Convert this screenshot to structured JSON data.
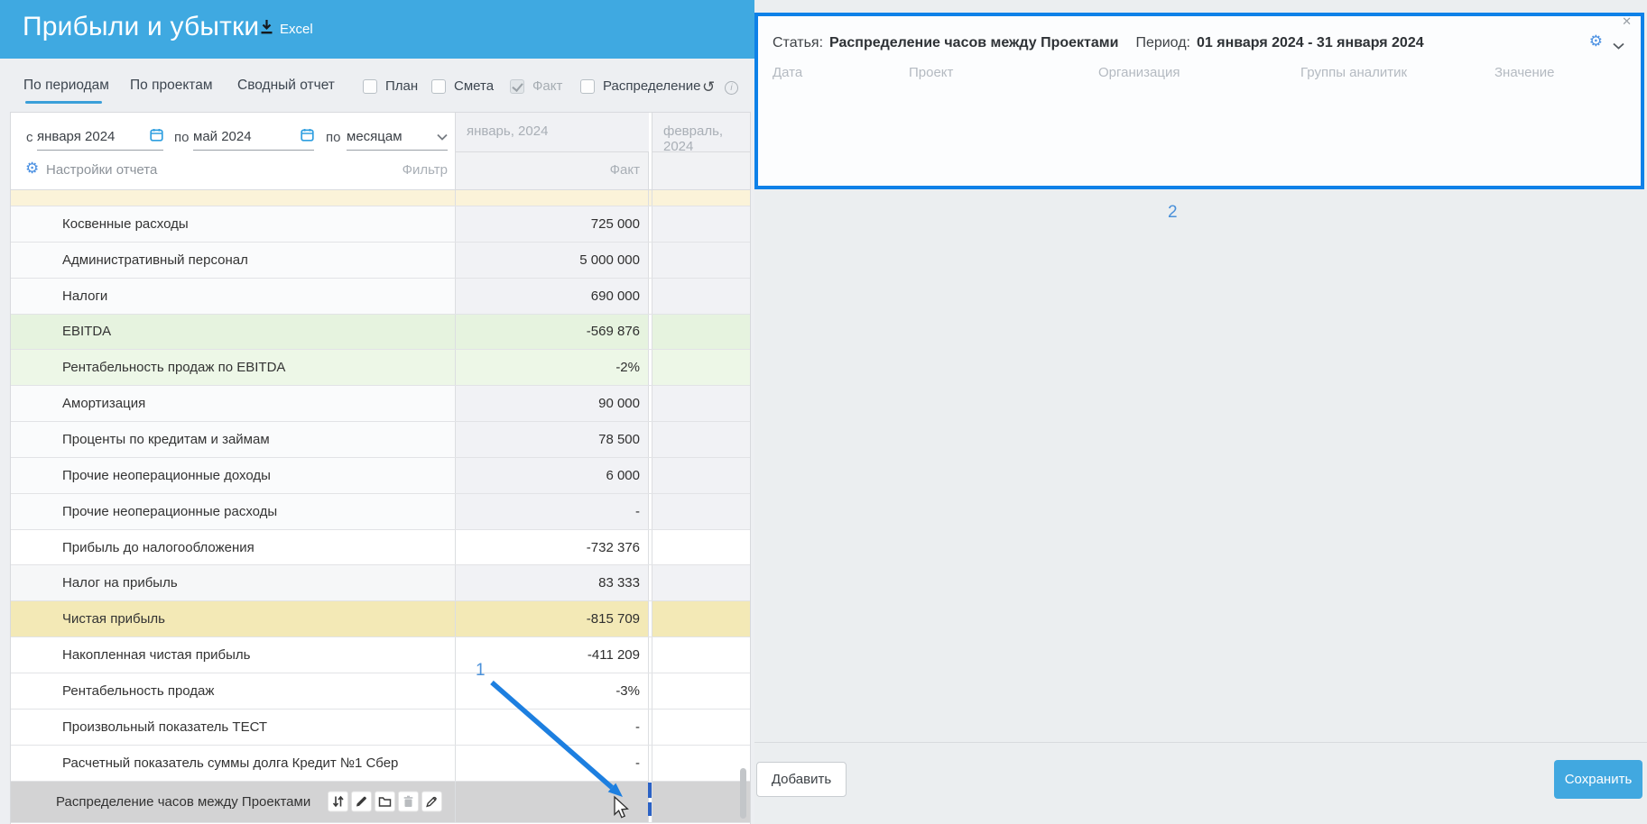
{
  "header": {
    "title": "Прибыли и убытки",
    "excel_label": "Excel"
  },
  "tabs": {
    "items": [
      {
        "label": "По периодам",
        "active": true
      },
      {
        "label": "По проектам",
        "active": false
      },
      {
        "label": "Сводный отчет",
        "active": false
      }
    ]
  },
  "toggles": {
    "items": [
      {
        "label": "План",
        "checked": false,
        "disabled": false
      },
      {
        "label": "Смета",
        "checked": false,
        "disabled": false
      },
      {
        "label": "Факт",
        "checked": true,
        "disabled": true
      },
      {
        "label": "Распределение",
        "checked": false,
        "disabled": false
      }
    ]
  },
  "period_filter": {
    "from_label": "с",
    "from_value": "января 2024",
    "to_label": "по",
    "to_value": "май 2024",
    "group_label": "по",
    "group_value": "месяцам"
  },
  "report": {
    "settings_label": "Настройки отчета",
    "filter_label": "Фильтр",
    "columns": [
      {
        "month": "январь, 2024",
        "sub": "Факт"
      },
      {
        "month": "февраль, 2024",
        "sub": ""
      }
    ]
  },
  "table": {
    "rows": [
      {
        "label": "Косвенные расходы",
        "value": "725 000",
        "type": "group",
        "expandable": true
      },
      {
        "label": "Административный персонал",
        "value": "5 000 000",
        "type": "group",
        "expandable": true
      },
      {
        "label": "Налоги",
        "value": "690 000",
        "type": "group",
        "expandable": true
      },
      {
        "label": "EBITDA",
        "value": "-569 876",
        "type": "ebitda",
        "expandable": false
      },
      {
        "label": "Рентабельность продаж по EBITDA",
        "value": "-2%",
        "type": "ebitda2",
        "expandable": false
      },
      {
        "label": "Амортизация",
        "value": "90 000",
        "type": "group",
        "expandable": true
      },
      {
        "label": "Проценты по кредитам и займам",
        "value": "78 500",
        "type": "group",
        "expandable": true
      },
      {
        "label": "Прочие неоперационные доходы",
        "value": "6 000",
        "type": "group",
        "expandable": true
      },
      {
        "label": "Прочие неоперационные расходы",
        "value": "-",
        "type": "group",
        "expandable": true
      },
      {
        "label": "Прибыль до налогообложения",
        "value": "-732 376",
        "type": "plain",
        "expandable": false
      },
      {
        "label": "Налог на прибыль",
        "value": "83 333",
        "type": "shaded",
        "expandable": false
      },
      {
        "label": "Чистая прибыль",
        "value": "-815 709",
        "type": "net",
        "expandable": false
      },
      {
        "label": "Накопленная чистая прибыль",
        "value": "-411 209",
        "type": "plain",
        "expandable": false
      },
      {
        "label": "Рентабельность продаж",
        "value": "-3%",
        "type": "plain",
        "expandable": false
      },
      {
        "label": "Произвольный показатель ТЕСТ",
        "value": "-",
        "type": "plain",
        "expandable": false
      },
      {
        "label": "Расчетный показатель суммы долга Кредит №1 Сбер",
        "value": "-",
        "type": "plain",
        "expandable": false
      },
      {
        "label": "Распределение часов между Проектами",
        "value": "",
        "type": "selected",
        "expandable": false
      }
    ]
  },
  "panel": {
    "article_label": "Статья:",
    "article_value": "Распределение часов между Проектами",
    "period_label": "Период:",
    "period_value": "01 января 2024 - 31 января 2024",
    "columns": [
      "Дата",
      "Проект",
      "Организация",
      "Группы аналитик",
      "Значение"
    ],
    "add_label": "Добавить",
    "save_label": "Сохранить",
    "close_glyph": "✕"
  },
  "annotations": {
    "step1": "1",
    "step2": "2"
  },
  "colors": {
    "header_blue": "#3fa9e1",
    "panel_border": "#0e81e8",
    "save_button": "#41a8e0",
    "arrow_blue": "#1d7fe0",
    "selected_row": "#d3d3d4",
    "net_profit_row": "#f3e9b6",
    "ebitda_row": "#e6f3df"
  }
}
